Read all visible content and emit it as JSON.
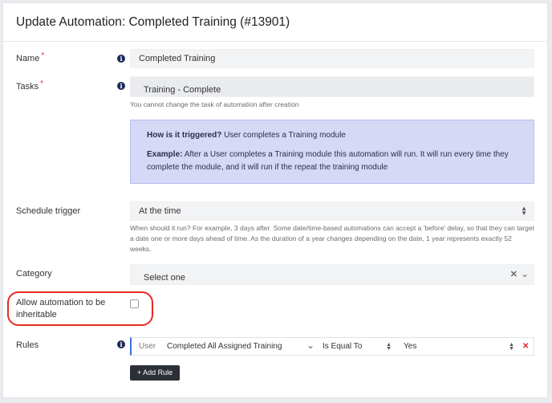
{
  "header": {
    "title": "Update Automation: Completed Training (#13901)"
  },
  "form": {
    "name": {
      "label": "Name",
      "required_mark": "*",
      "value": "Completed Training"
    },
    "tasks": {
      "label": "Tasks",
      "required_mark": "*",
      "value": "Training - Complete",
      "help": "You cannot change the task of automation after creation"
    },
    "trigger_info": {
      "how_label": "How is it triggered?",
      "how_text": " User completes a Training module",
      "example_label": "Example:",
      "example_text": " After a User completes a Training module this automation will run. It will run every time they complete the module, and it will run if the repeat the training module"
    },
    "schedule": {
      "label": "Schedule trigger",
      "value": "At the time",
      "help": "When should it run? For example, 3 days after. Some date/time-based automations can accept a 'before' delay, so that they can target a date one or more days ahead of time. As the duration of a year changes depending on the date, 1 year represents exactly 52 weeks."
    },
    "category": {
      "label": "Category",
      "placeholder": "Select one"
    },
    "inheritable": {
      "label": "Allow automation to be inheritable",
      "checked": false
    },
    "rules": {
      "label": "Rules",
      "rows": [
        {
          "entity": "User",
          "field": "Completed All Assigned Training",
          "operator": "Is Equal To",
          "value": "Yes"
        }
      ],
      "add_label": "+ Add Rule"
    }
  },
  "icons": {
    "info": "info-circle-icon",
    "select": "select-arrows-icon",
    "clear": "clear-x-icon",
    "chevron": "chevron-down-icon",
    "delete": "delete-x-icon"
  },
  "colors": {
    "callout_bg": "#d6d8f6",
    "highlight": "#e52b20",
    "required": "#d9342b",
    "button": "#2b2f36",
    "delete": "#e02424"
  }
}
